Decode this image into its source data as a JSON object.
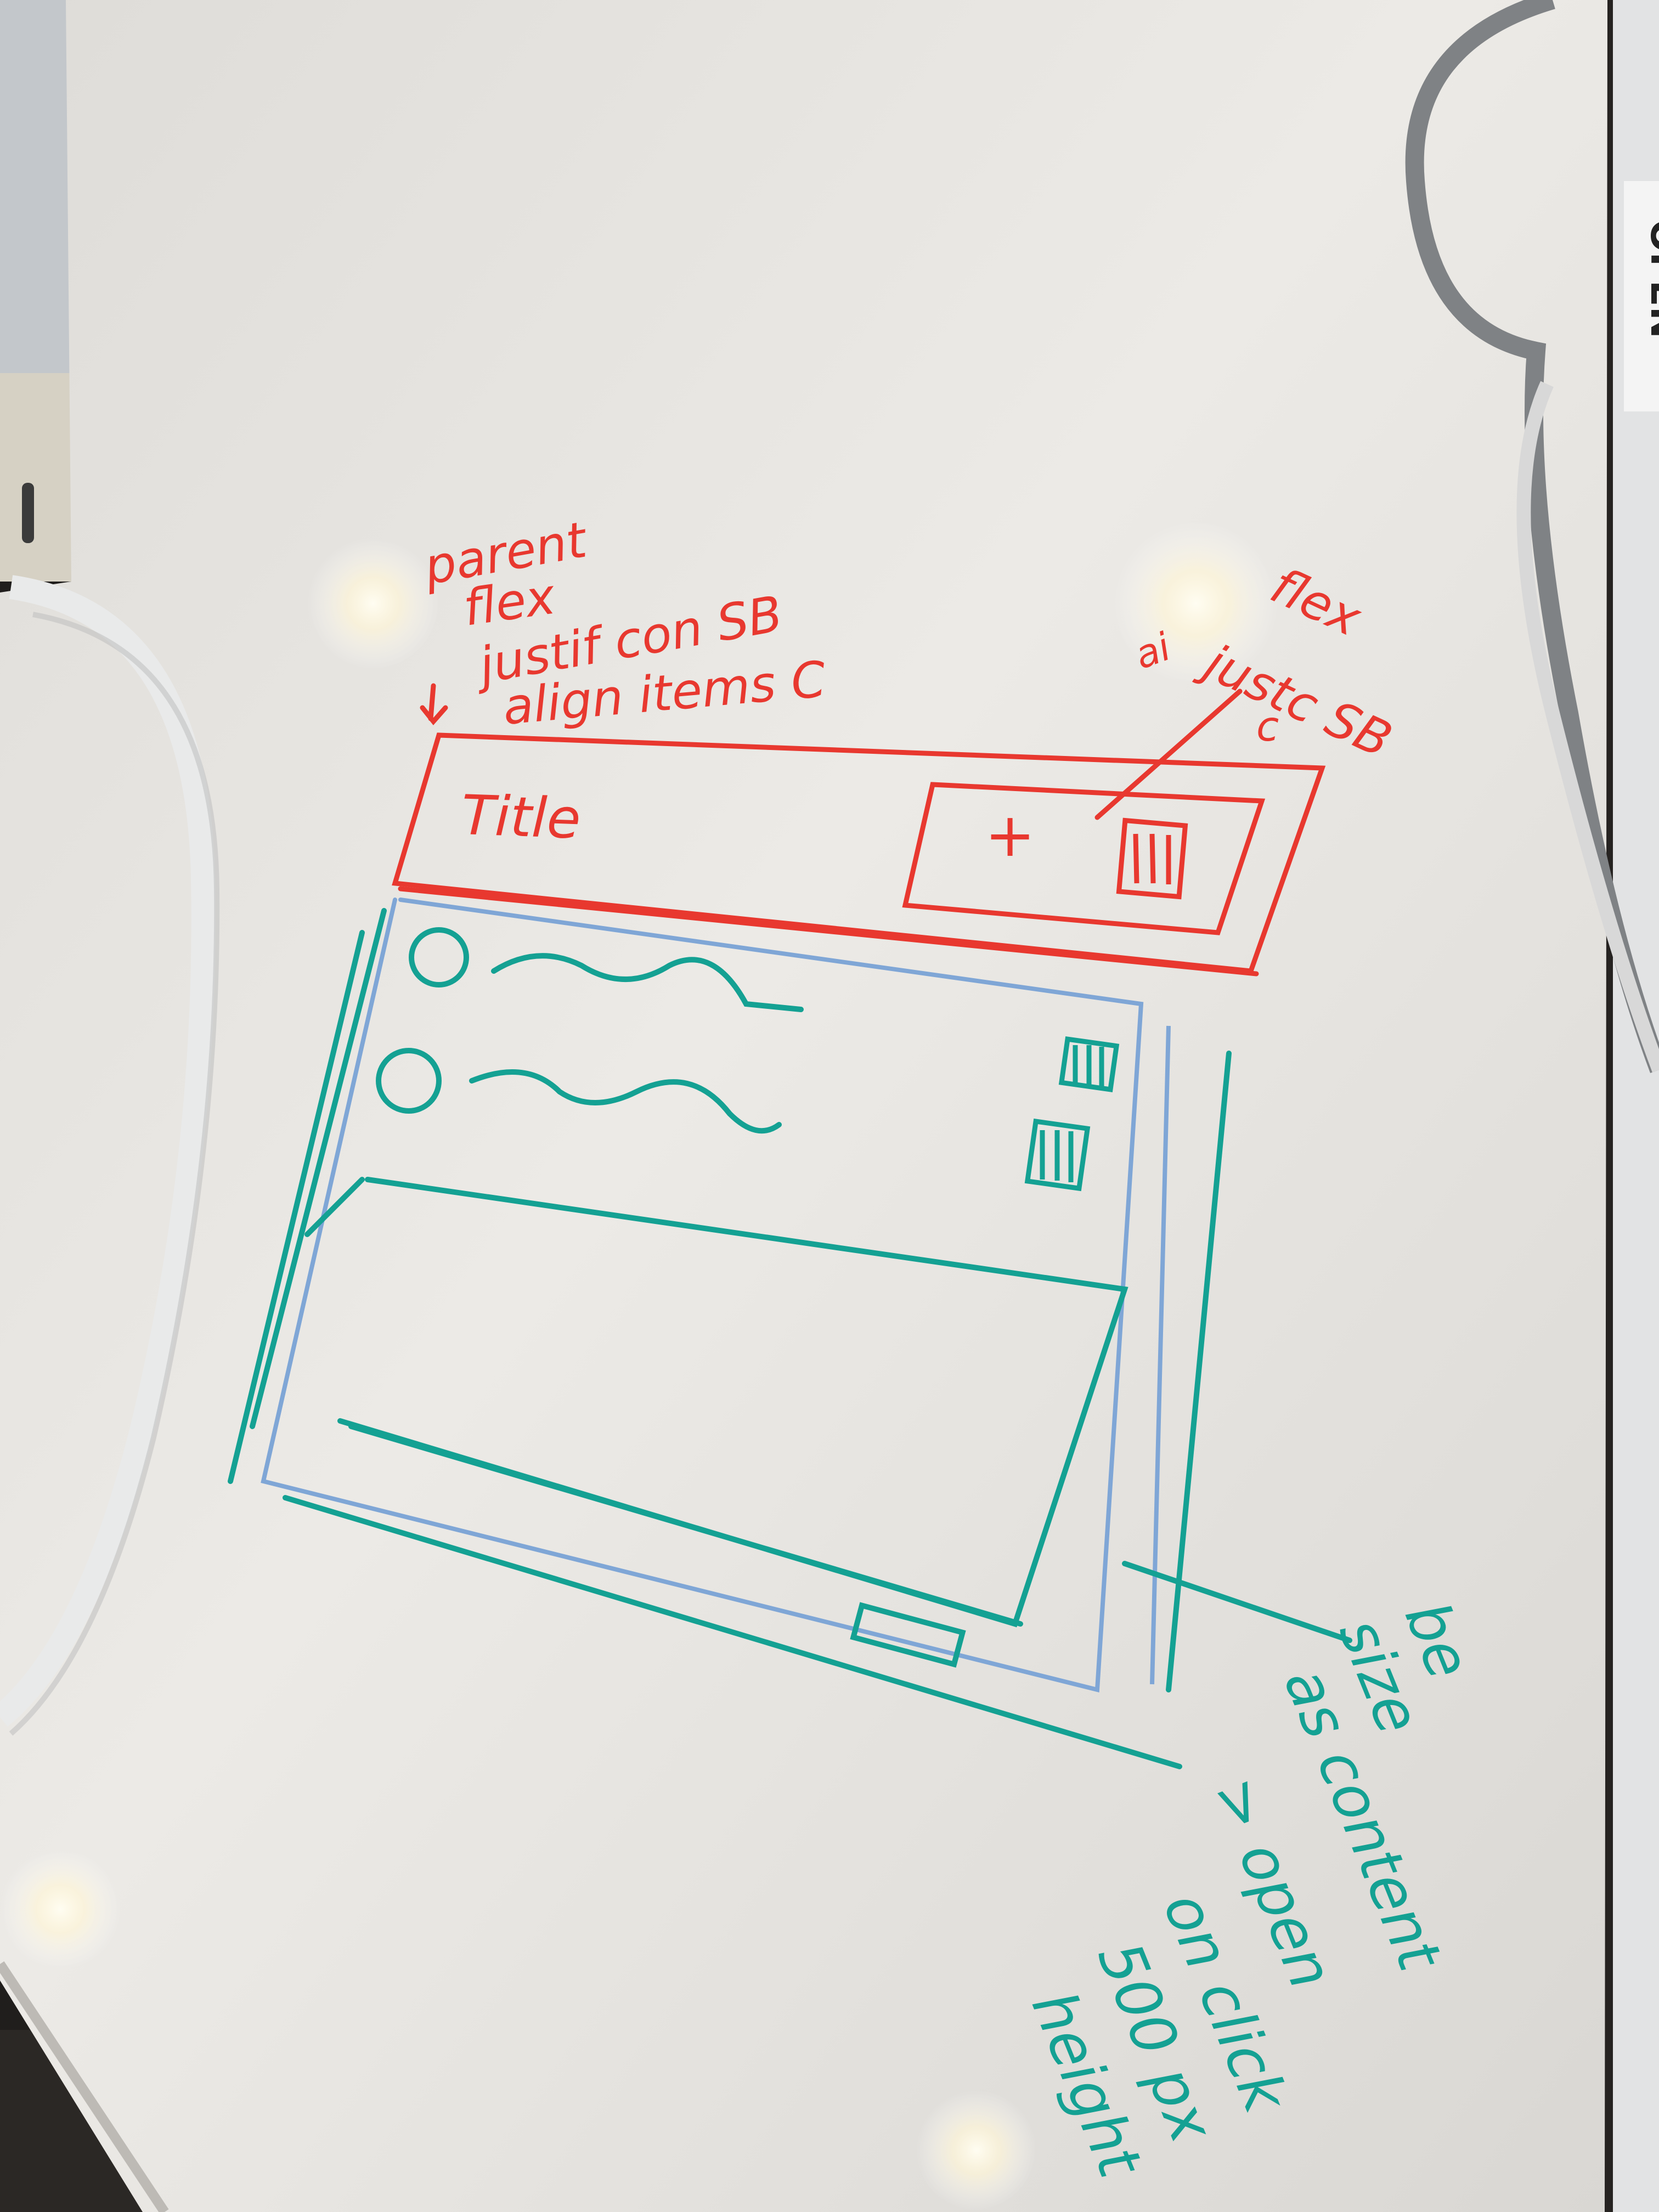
{
  "notes": {
    "parent": "parent",
    "flex": "flex",
    "justify": "justif con SB",
    "align": "align items C",
    "title": "Title",
    "plus": "+",
    "right_flex": "flex",
    "right_justify": "justc SB",
    "right_align": "ai",
    "right_c": "c",
    "size_note": [
      "be",
      "size",
      "as content"
    ],
    "open_note": [
      "> open",
      "on click",
      "500 px",
      "height"
    ]
  },
  "laptop_label": "OPEN",
  "colors": {
    "board": "#ecebe8",
    "red_marker": "#e8382f",
    "teal_marker": "#14a193",
    "blue_marker": "#7fa6d6"
  }
}
